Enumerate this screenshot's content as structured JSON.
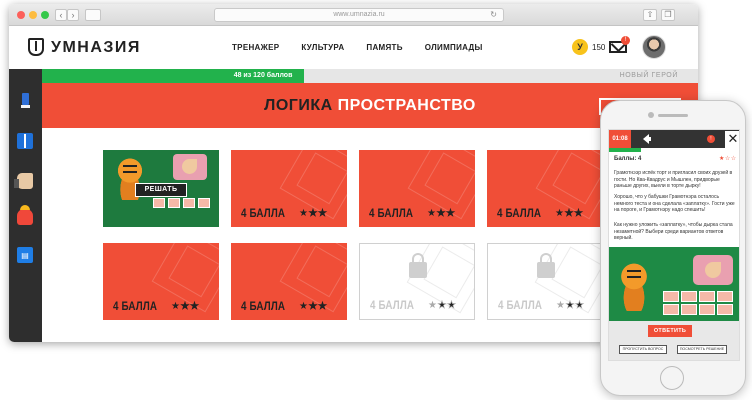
{
  "browser": {
    "url": "www.umnazia.ru",
    "back_glyph": "‹",
    "forward_glyph": "›"
  },
  "header": {
    "logo_text": "УМНАЗИЯ",
    "nav": [
      "ТРЕНАЖЕР",
      "КУЛЬТУРА",
      "ПАМЯТЬ",
      "ОЛИМПИАДЫ"
    ],
    "coin_letter": "У",
    "coin_count": "150",
    "mail_badge": "!"
  },
  "sidebar": {
    "icons": [
      "pencil-icon",
      "book-icon",
      "thumb-icon",
      "pot-icon",
      "calendar-icon"
    ],
    "calendar_glyph": "▤"
  },
  "progress": {
    "label": "48 из 120 баллов",
    "current": 48,
    "total": 120,
    "next_rank": "НОВЫЙ ГЕРОЙ"
  },
  "banner": {
    "title_part1": "ЛОГИКА",
    "title_part2": "ПРОСТРАНСТВО"
  },
  "cards": [
    {
      "kind": "featured",
      "button": "РЕШАТЬ"
    },
    {
      "kind": "red",
      "points": "4 БАЛЛА",
      "stars": 1
    },
    {
      "kind": "red",
      "points": "4 БАЛЛА",
      "stars": 1
    },
    {
      "kind": "red",
      "points": "4 БАЛЛА",
      "stars": 1
    },
    {
      "kind": "red",
      "points": "4 БАЛЛА",
      "stars": 1
    },
    {
      "kind": "red",
      "points": "4 БАЛЛА",
      "stars": 1
    },
    {
      "kind": "locked",
      "points": "4 БАЛЛА",
      "stars": 1
    },
    {
      "kind": "locked",
      "points": "4 БАЛЛА",
      "stars": 1
    }
  ],
  "phone": {
    "timer": "01:08",
    "alert": "!",
    "close": "✕",
    "score": "Баллы: 4",
    "stars": "★☆☆",
    "p1": "Грамотнээр испёк торт и пригласил своих друзей в гости. Но Ква-Квадрус и Мышлен, придворые раньше других, выели в торте дырку!",
    "p2": "Хорошо, что у бабушки Грамотнэра осталось немного теста и она сделала «заплатку». Гости уже на пороге, и Грамотнэру надо спешить!",
    "p3": "Как нужно уложить «заплатку», чтобы дырка стала незаметной? Выбери среди вариантов ответов верный.",
    "answer_button": "ОТВЕТИТЬ",
    "skip_button": "ПРОПУСТИТЬ ВОПРОС",
    "show_button": "ПОСМОТРЕТЬ РЕШЕНИЕ"
  },
  "colors": {
    "accent": "#f04e37",
    "progress": "#22b24c",
    "sidebar": "#2e2e2e",
    "coin": "#f8c31b"
  }
}
